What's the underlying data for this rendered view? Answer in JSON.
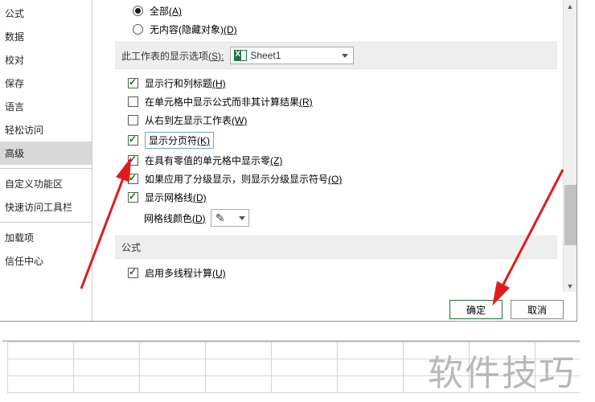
{
  "sidebar": {
    "items": [
      {
        "label": "公式"
      },
      {
        "label": "数据"
      },
      {
        "label": "校对"
      },
      {
        "label": "保存"
      },
      {
        "label": "语言"
      },
      {
        "label": "轻松访问"
      },
      {
        "label": "高级"
      },
      {
        "label": "自定义功能区"
      },
      {
        "label": "快速访问工具栏"
      },
      {
        "label": "加载项"
      },
      {
        "label": "信任中心"
      }
    ]
  },
  "radios": {
    "all": {
      "label": "全部",
      "accel": "(A)"
    },
    "none": {
      "label": "无内容(隐藏对象)",
      "accel": "(D)"
    }
  },
  "sheet_section": {
    "title": "此工作表的显示选项",
    "accel": "(S):",
    "selected": "Sheet1"
  },
  "checks": {
    "row_col_headers": {
      "label": "显示行和列标题",
      "accel": "(H)"
    },
    "show_formulas": {
      "label": "在单元格中显示公式而非其计算结果",
      "accel": "(R)"
    },
    "rtl": {
      "label": "从右到左显示工作表",
      "accel": "(W)"
    },
    "page_breaks": {
      "label": "显示分页符",
      "accel": "(K)"
    },
    "zero_values": {
      "label": "在具有零值的单元格中显示零",
      "accel": "(Z)"
    },
    "outline_symbols": {
      "label": "如果应用了分级显示，则显示分级显示符号",
      "accel": "(O)"
    },
    "gridlines": {
      "label": "显示网格线",
      "accel": "(D)"
    }
  },
  "gridline_color": {
    "label": "网格线颜色",
    "accel": "(D)"
  },
  "formula_section": {
    "title": "公式"
  },
  "multithread": {
    "label": "启用多线程计算",
    "accel": "(U)"
  },
  "buttons": {
    "ok": "确定",
    "cancel": "取消"
  },
  "watermark": "软件技巧"
}
